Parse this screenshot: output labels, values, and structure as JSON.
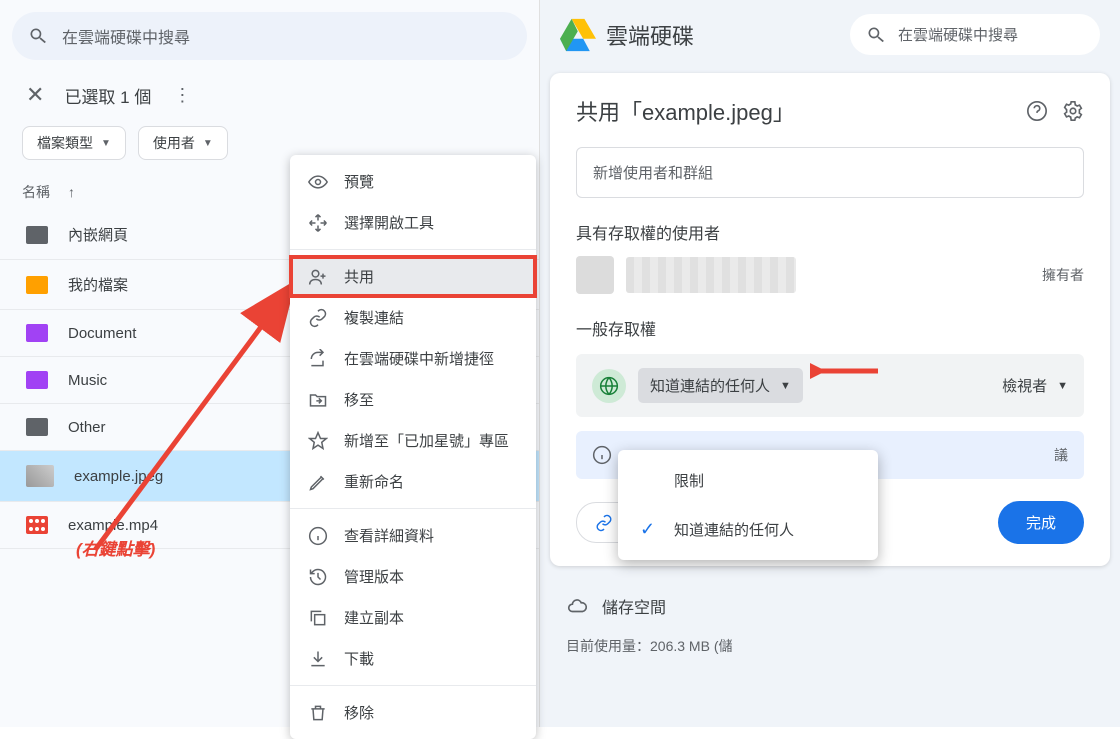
{
  "left": {
    "search_placeholder": "在雲端硬碟中搜尋",
    "selected_text": "已選取 1 個",
    "chip_filetype": "檔案類型",
    "chip_user": "使用者",
    "col_name": "名稱",
    "files": [
      {
        "name": "內嵌網頁",
        "icon": "gray"
      },
      {
        "name": "我的檔案",
        "icon": "orange"
      },
      {
        "name": "Document",
        "icon": "purple"
      },
      {
        "name": "Music",
        "icon": "purple"
      },
      {
        "name": "Other",
        "icon": "gray"
      },
      {
        "name": "example.jpeg",
        "icon": "thumb",
        "selected": true
      },
      {
        "name": "example.mp4",
        "icon": "video"
      }
    ],
    "annotation": "(右鍵點擊)"
  },
  "ctx": {
    "preview": "預覽",
    "open_with": "選擇開啟工具",
    "share": "共用",
    "copy_link": "複製連結",
    "add_shortcut": "在雲端硬碟中新增捷徑",
    "move": "移至",
    "add_star": "新增至「已加星號」專區",
    "rename": "重新命名",
    "details": "查看詳細資料",
    "versions": "管理版本",
    "copy": "建立副本",
    "download": "下載",
    "remove": "移除"
  },
  "right": {
    "drive_name": "雲端硬碟",
    "search_placeholder": "在雲端硬碟中搜尋",
    "dlg_title": "共用「example.jpeg」",
    "add_placeholder": "新增使用者和群組",
    "access_label": "具有存取權的使用者",
    "owner": "擁有者",
    "general_access": "一般存取權",
    "anyone_link": "知道連結的任何人",
    "viewer": "檢視者",
    "info_text": "議",
    "copy_link": "複製連結",
    "done": "完成",
    "dd_restricted": "限制",
    "dd_anyone": "知道連結的任何人",
    "storage": "儲存空間",
    "bottom": "目前使用量：206.3 MB (儲"
  }
}
